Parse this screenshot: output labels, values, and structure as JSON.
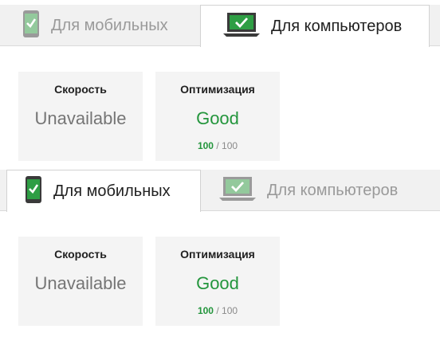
{
  "panels": [
    {
      "tabs": {
        "mobile": {
          "label": "Для мобильных",
          "icon": "smartphone-icon",
          "active": false
        },
        "desktop": {
          "label": "Для компьютеров",
          "icon": "laptop-icon",
          "active": true
        }
      },
      "speed": {
        "title": "Скорость",
        "value": "Unavailable"
      },
      "optimization": {
        "title": "Оптимизация",
        "value": "Good",
        "score": "100",
        "separator": "/",
        "max": "100"
      }
    },
    {
      "tabs": {
        "mobile": {
          "label": "Для мобильных",
          "icon": "smartphone-icon",
          "active": true
        },
        "desktop": {
          "label": "Для компьютеров",
          "icon": "laptop-icon",
          "active": false
        }
      },
      "speed": {
        "title": "Скорость",
        "value": "Unavailable"
      },
      "optimization": {
        "title": "Оптимизация",
        "value": "Good",
        "score": "100",
        "separator": "/",
        "max": "100"
      }
    }
  ],
  "colors": {
    "good": "#23953c",
    "icon_green": "#2e9e44",
    "icon_green_faded": "#93c99c"
  }
}
